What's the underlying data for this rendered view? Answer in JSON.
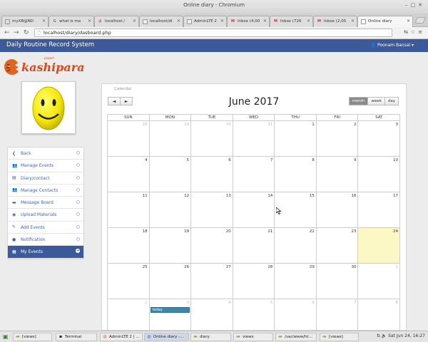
{
  "window": {
    "title": "Online diary - Chromium"
  },
  "tabs": [
    {
      "label": "myXB@ND",
      "icon": "page-icon"
    },
    {
      "label": "what is ma",
      "icon": "google-icon"
    },
    {
      "label": "localhost / ",
      "icon": "pma-icon"
    },
    {
      "label": "localhost/di",
      "icon": "page-icon"
    },
    {
      "label": "AdminLTE 2",
      "icon": "page-icon"
    },
    {
      "label": "Inbox (4,00",
      "icon": "gmail-icon"
    },
    {
      "label": "Inbox (726",
      "icon": "gmail-icon"
    },
    {
      "label": "Inbox (2,05",
      "icon": "gmail-icon"
    },
    {
      "label": "Online diary",
      "icon": "page-icon"
    }
  ],
  "address": {
    "url": "localhost/diary/dasboard.php"
  },
  "header": {
    "brand": "Daily Routine Record System",
    "user": "Poonam Bansal"
  },
  "logo": {
    "name": "kashipara",
    "tagline": "project"
  },
  "menu": [
    {
      "label": "Back",
      "icon": "chevron-left-icon"
    },
    {
      "label": "Manage Events",
      "icon": "users-icon"
    },
    {
      "label": "Diary/contact",
      "icon": "book-icon"
    },
    {
      "label": "Manage Contacts",
      "icon": "users-icon"
    },
    {
      "label": "Message Board",
      "icon": "comment-icon"
    },
    {
      "label": "Upload Materials",
      "icon": "upload-icon"
    },
    {
      "label": "Add Events",
      "icon": "edit-icon"
    },
    {
      "label": "Notification",
      "icon": "info-icon"
    },
    {
      "label": "My Events",
      "icon": "calendar-icon"
    }
  ],
  "calendar": {
    "panel_title": "Calendar",
    "title": "June 2017",
    "prev": "◄",
    "next": "►",
    "views": [
      "month",
      "week",
      "day"
    ],
    "active_view": "month",
    "weekdays": [
      "SUN",
      "MON",
      "TUE",
      "WED",
      "THU",
      "FRI",
      "SAT"
    ],
    "weeks": [
      [
        "28",
        "29",
        "30",
        "31",
        "1",
        "2",
        "3"
      ],
      [
        "4",
        "5",
        "6",
        "7",
        "8",
        "9",
        "10"
      ],
      [
        "11",
        "12",
        "13",
        "14",
        "15",
        "16",
        "17"
      ],
      [
        "18",
        "19",
        "20",
        "21",
        "22",
        "23",
        "24"
      ],
      [
        "25",
        "26",
        "27",
        "28",
        "29",
        "30",
        "1"
      ],
      [
        "2",
        "3",
        "4",
        "5",
        "6",
        "7",
        "8"
      ]
    ],
    "today": "24",
    "event": {
      "label": "today"
    }
  },
  "taskbar": [
    {
      "label": "[views]",
      "icon": "folder-icon"
    },
    {
      "label": "Terminal",
      "icon": "terminal-icon"
    },
    {
      "label": "AdminLTE 2 | ...",
      "icon": "browser-icon"
    },
    {
      "label": "Online diary -...",
      "icon": "browser-icon"
    },
    {
      "label": "diary",
      "icon": "folder-icon"
    },
    {
      "label": "views",
      "icon": "folder-icon"
    },
    {
      "label": "/var/www/ht...",
      "icon": "folder-icon"
    },
    {
      "label": "[views]",
      "icon": "folder-icon"
    }
  ],
  "clock": "Sat Jun 24, 16:27"
}
